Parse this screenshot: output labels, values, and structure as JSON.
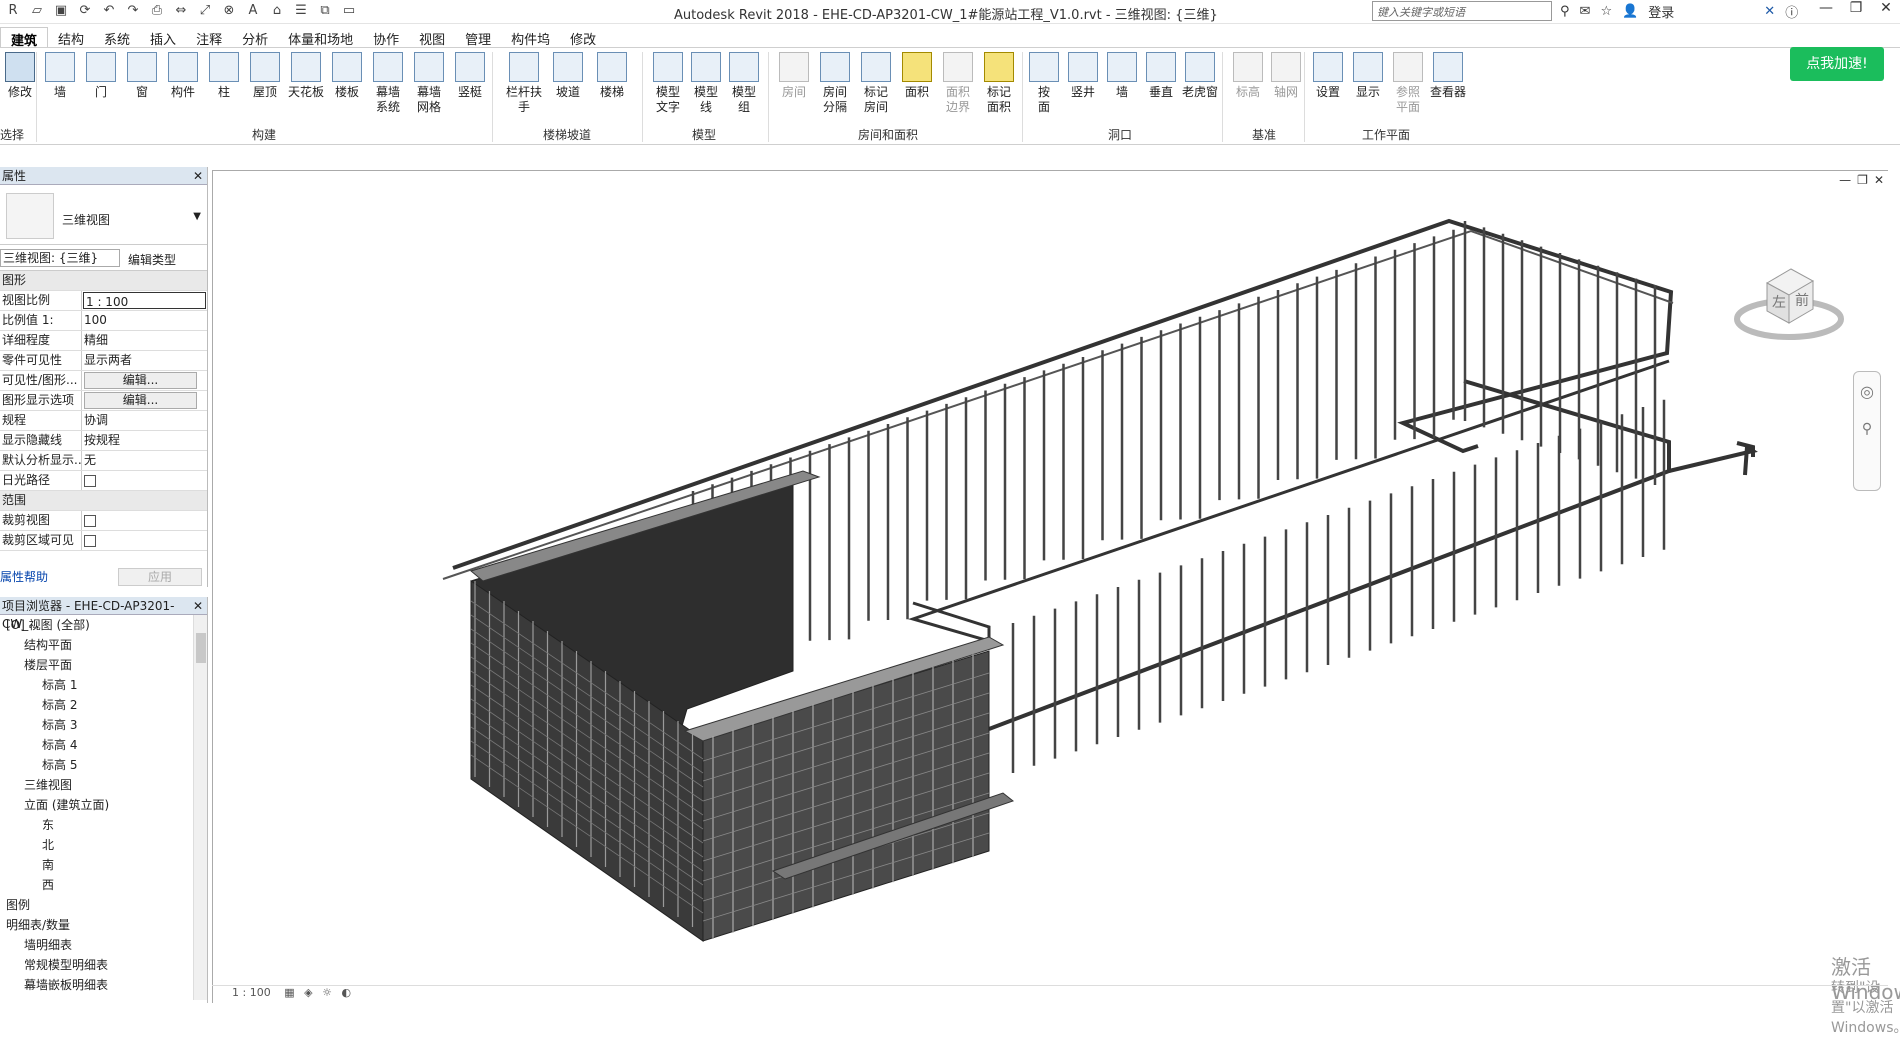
{
  "titlebar": {
    "title": "Autodesk Revit 2018 -     EHE-CD-AP3201-CW_1#能源站工程_V1.0.rvt - 三维视图: {三维}",
    "search_placeholder": "键入关键字或短语",
    "login": "登录",
    "qa_icons": [
      "open-icon",
      "save-icon",
      "sync-icon",
      "undo-icon",
      "redo-icon",
      "print-icon",
      "measure-icon",
      "dimension-icon",
      "tag-icon",
      "text-A-icon",
      "3d-icon",
      "thin-lines-icon",
      "close-hidden-icon",
      "switch-windows-icon"
    ]
  },
  "tabs": [
    "建筑",
    "结构",
    "系统",
    "插入",
    "注释",
    "分析",
    "体量和场地",
    "协作",
    "视图",
    "管理",
    "构件坞",
    "修改"
  ],
  "active_tab": "建筑",
  "ribbon": {
    "modify": "修改",
    "select": "选择",
    "build_tools": [
      {
        "label": "墙"
      },
      {
        "label": "门"
      },
      {
        "label": "窗"
      },
      {
        "label": "构件"
      },
      {
        "label": "柱"
      },
      {
        "label": "屋顶"
      },
      {
        "label": "天花板"
      },
      {
        "label": "楼板"
      },
      {
        "label": "幕墙\n系统"
      },
      {
        "label": "幕墙\n网格"
      },
      {
        "label": "竖梃"
      }
    ],
    "build_group": "构建",
    "stair_tools": [
      {
        "label": "栏杆扶手"
      },
      {
        "label": "坡道"
      },
      {
        "label": "楼梯"
      }
    ],
    "stair_group": "楼梯坡道",
    "model_tools": [
      {
        "label": "模型\n文字"
      },
      {
        "label": "模型\n线"
      },
      {
        "label": "模型\n组"
      }
    ],
    "model_group": "模型",
    "room_tools": [
      {
        "label": "房间"
      },
      {
        "label": "房间\n分隔"
      },
      {
        "label": "标记\n房间"
      },
      {
        "label": "面积"
      },
      {
        "label": "面积\n边界"
      },
      {
        "label": "标记\n面积"
      }
    ],
    "room_group": "房间和面积",
    "opening_tools": [
      {
        "label": "按\n面"
      },
      {
        "label": "竖井"
      },
      {
        "label": "墙"
      },
      {
        "label": "垂直"
      },
      {
        "label": "老虎窗"
      }
    ],
    "opening_group": "洞口",
    "datum_tools": [
      {
        "label": "标高"
      },
      {
        "label": "轴网"
      }
    ],
    "datum_group": "基准",
    "wp_tools": [
      {
        "label": "设置"
      },
      {
        "label": "显示"
      },
      {
        "label": "参照\n平面"
      },
      {
        "label": "查看器"
      }
    ],
    "wp_group": "工作平面",
    "promo": "点我加速!"
  },
  "properties": {
    "title": "属性",
    "type_name": "三维视图",
    "view_selector": "三维视图: {三维}",
    "edit_type": "编辑类型",
    "sections": [
      {
        "name": "图形",
        "rows": [
          {
            "k": "视图比例",
            "v": "1 : 100",
            "input": true
          },
          {
            "k": "比例值 1:",
            "v": "100"
          },
          {
            "k": "详细程度",
            "v": "精细"
          },
          {
            "k": "零件可见性",
            "v": "显示两者"
          },
          {
            "k": "可见性/图形...",
            "v": "编辑...",
            "button": true
          },
          {
            "k": "图形显示选项",
            "v": "编辑...",
            "button": true
          },
          {
            "k": "规程",
            "v": "协调"
          },
          {
            "k": "显示隐藏线",
            "v": "按规程"
          },
          {
            "k": "默认分析显示...",
            "v": "无"
          },
          {
            "k": "日光路径",
            "v": "",
            "check": true
          }
        ]
      },
      {
        "name": "范围",
        "rows": [
          {
            "k": "裁剪视图",
            "v": "",
            "check": true
          },
          {
            "k": "裁剪区域可见",
            "v": "",
            "check": true
          }
        ]
      }
    ],
    "help": "属性帮助",
    "apply": "应用"
  },
  "browser": {
    "title": "项目浏览器 - EHE-CD-AP3201-CW_...",
    "items": [
      {
        "text": "[O] 视图 (全部)",
        "indent": 0
      },
      {
        "text": "结构平面",
        "indent": 1
      },
      {
        "text": "楼层平面",
        "indent": 1
      },
      {
        "text": "标高 1",
        "indent": 2
      },
      {
        "text": "标高 2",
        "indent": 2
      },
      {
        "text": "标高 3",
        "indent": 2
      },
      {
        "text": "标高 4",
        "indent": 2
      },
      {
        "text": "标高 5",
        "indent": 2
      },
      {
        "text": "三维视图",
        "indent": 1
      },
      {
        "text": "立面 (建筑立面)",
        "indent": 1
      },
      {
        "text": "东",
        "indent": 2
      },
      {
        "text": "北",
        "indent": 2
      },
      {
        "text": "南",
        "indent": 2
      },
      {
        "text": "西",
        "indent": 2
      },
      {
        "text": "图例",
        "indent": 0
      },
      {
        "text": "明细表/数量",
        "indent": 0
      },
      {
        "text": "墙明细表",
        "indent": 1
      },
      {
        "text": "常规模型明细表",
        "indent": 1
      },
      {
        "text": "幕墙嵌板明细表",
        "indent": 1
      }
    ]
  },
  "view": {
    "viewcube_left": "左",
    "viewcube_front": "前",
    "watermark_title": "激活 Windows",
    "watermark_sub": "转到\"设置\"以激活 Windows。",
    "scale": "1 : 100"
  }
}
